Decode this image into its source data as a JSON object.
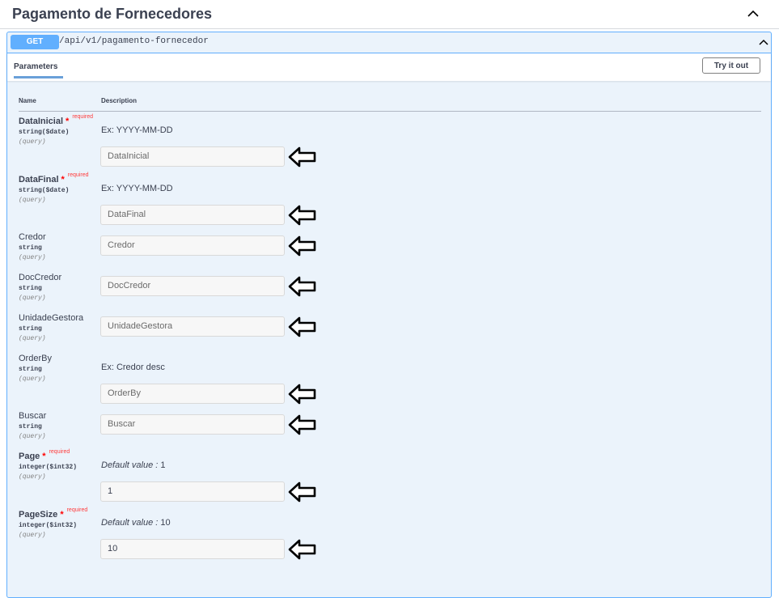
{
  "section": {
    "title": "Pagamento de Fornecedores"
  },
  "operation": {
    "method": "GET",
    "path": "/api/v1/pagamento-fornecedor",
    "method_color": "#61affe"
  },
  "tabs": {
    "parameters_label": "Parameters",
    "try_it_out_label": "Try it out"
  },
  "columns": {
    "name": "Name",
    "description": "Description"
  },
  "required_label": "required",
  "required_star": "*",
  "default_value_label": "Default value :",
  "parameters": [
    {
      "name": "DataInicial",
      "required": true,
      "type": "string($date)",
      "in": "(query)",
      "description": "Ex: YYYY-MM-DD",
      "placeholder": "DataInicial",
      "value": ""
    },
    {
      "name": "DataFinal",
      "required": true,
      "type": "string($date)",
      "in": "(query)",
      "description": "Ex: YYYY-MM-DD",
      "placeholder": "DataFinal",
      "value": ""
    },
    {
      "name": "Credor",
      "required": false,
      "type": "string",
      "in": "(query)",
      "description": "",
      "placeholder": "Credor",
      "value": ""
    },
    {
      "name": "DocCredor",
      "required": false,
      "type": "string",
      "in": "(query)",
      "description": "",
      "placeholder": "DocCredor",
      "value": ""
    },
    {
      "name": "UnidadeGestora",
      "required": false,
      "type": "string",
      "in": "(query)",
      "description": "",
      "placeholder": "UnidadeGestora",
      "value": ""
    },
    {
      "name": "OrderBy",
      "required": false,
      "type": "string",
      "in": "(query)",
      "description": "Ex: Credor desc",
      "placeholder": "OrderBy",
      "value": ""
    },
    {
      "name": "Buscar",
      "required": false,
      "type": "string",
      "in": "(query)",
      "description": "",
      "placeholder": "Buscar",
      "value": ""
    },
    {
      "name": "Page",
      "required": true,
      "type": "integer($int32)",
      "in": "(query)",
      "default_value": "1",
      "placeholder": "",
      "value": "1"
    },
    {
      "name": "PageSize",
      "required": true,
      "type": "integer($int32)",
      "in": "(query)",
      "default_value": "10",
      "placeholder": "",
      "value": "10"
    }
  ]
}
